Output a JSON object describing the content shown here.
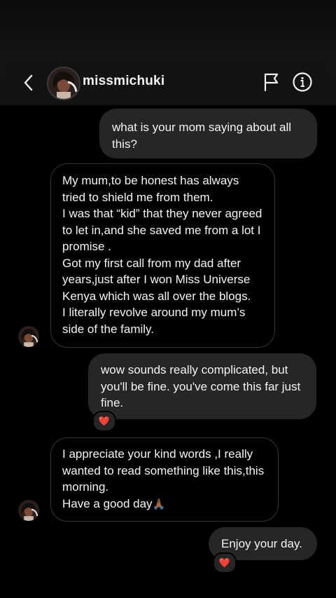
{
  "header": {
    "username": "missmichuki"
  },
  "messages": [
    {
      "direction": "outgoing",
      "lines": [
        "what is your mom saying about all this?"
      ],
      "reaction": "❤️"
    },
    {
      "direction": "incoming",
      "lines": [
        "My mum,to be honest has always tried to shield me from them.",
        "I was that “kid” that they never agreed to let in,and she saved me from a lot I promise .",
        "Got my first call from my dad after years,just after I won Miss Universe Kenya which was all over the blogs.",
        "I literally revolve around my mum’s side of the family."
      ]
    },
    {
      "direction": "outgoing",
      "lines": [
        "wow sounds really complicated, but you'll be fine. you've come this far just fine."
      ],
      "reaction": "❤️"
    },
    {
      "direction": "incoming",
      "lines": [
        "I appreciate your kind words ,I really wanted to read something like this,this morning.",
        "Have a good day"
      ],
      "emoji": "🙏🏾"
    },
    {
      "direction": "outgoing",
      "lines": [
        "Enjoy your day."
      ],
      "reaction": "❤️"
    }
  ],
  "icons": {
    "back": "chevron-left-icon",
    "flag": "flag-icon",
    "info": "info-icon",
    "heart": "heart-icon"
  },
  "colors": {
    "background": "#000000",
    "header": "#121212",
    "outgoing_bubble": "#262626",
    "incoming_border": "#343434",
    "text": "#f5f5f5",
    "heart": "#ff2a3d"
  }
}
